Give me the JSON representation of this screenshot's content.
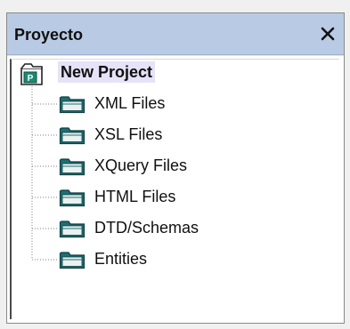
{
  "panel": {
    "title": "Proyecto",
    "close_icon": "close-icon"
  },
  "tree": {
    "root": {
      "label": "New Project",
      "icon": "project-icon"
    },
    "children": [
      {
        "label": "XML Files",
        "icon": "folder-icon"
      },
      {
        "label": "XSL Files",
        "icon": "folder-icon"
      },
      {
        "label": "XQuery Files",
        "icon": "folder-icon"
      },
      {
        "label": "HTML Files",
        "icon": "folder-icon"
      },
      {
        "label": "DTD/Schemas",
        "icon": "folder-icon"
      },
      {
        "label": "Entities",
        "icon": "folder-icon"
      }
    ]
  },
  "colors": {
    "title_bar": "#b9cbe4",
    "selection_highlight": "#e6e2f7",
    "folder_teal": "#1d6f73",
    "project_green": "#1b8a72"
  }
}
